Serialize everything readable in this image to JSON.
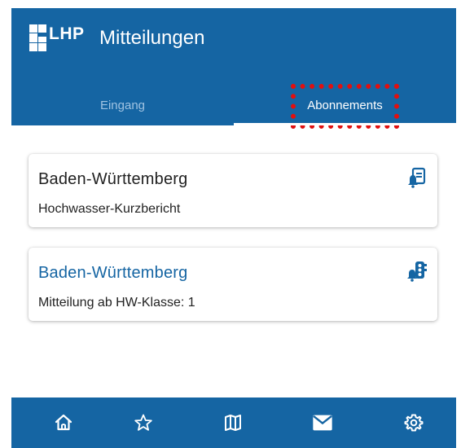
{
  "app": {
    "logo_text": "LHP",
    "title": "Mitteilungen",
    "brand_color": "#1565a3",
    "highlight_color": "#e11010"
  },
  "tabs": [
    {
      "label": "Eingang",
      "active": false
    },
    {
      "label": "Abonnements",
      "active": true
    }
  ],
  "subscriptions": [
    {
      "region": "Baden-Württemberg",
      "description": "Hochwasser-Kurzbericht",
      "icon": "report-bell-icon"
    },
    {
      "region": "Baden-Württemberg",
      "description": "Mitteilung ab HW-Klasse: 1",
      "icon": "traffic-light-bell-icon"
    }
  ],
  "bottom_nav": [
    {
      "icon": "home-icon"
    },
    {
      "icon": "star-icon"
    },
    {
      "icon": "map-icon"
    },
    {
      "icon": "mail-icon",
      "active": true
    },
    {
      "icon": "gear-icon"
    }
  ]
}
